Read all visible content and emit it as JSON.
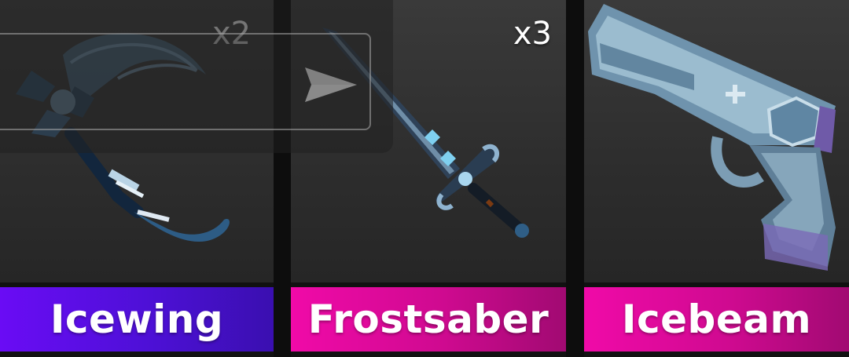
{
  "inventory": {
    "items": [
      {
        "name": "Icewing",
        "quantity": "x2",
        "label_color": "#5a0de6",
        "icon": "scythe-icon"
      },
      {
        "name": "Frostsaber",
        "quantity": "x3",
        "label_color": "#e20a9e",
        "icon": "sword-icon"
      },
      {
        "name": "Icebeam",
        "quantity": "",
        "label_color": "#e20a9e",
        "icon": "gun-icon"
      }
    ]
  },
  "chat": {
    "send_icon": "send-arrow-icon",
    "input_value": ""
  },
  "colors": {
    "card_bg": "#2f2f2f",
    "legendary_pink": "#e20a9e",
    "godly_purple": "#5a0de6"
  }
}
